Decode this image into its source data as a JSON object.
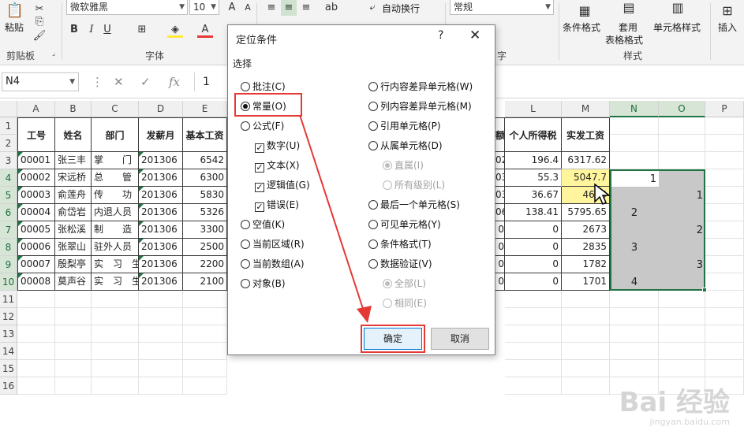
{
  "ribbon": {
    "paste_label": "粘贴",
    "clipboard_group": "剪贴板",
    "font_name": "微软雅黑",
    "font_size": "10",
    "font_group": "字体",
    "wrap_text": "自动换行",
    "number_format": "常规",
    "number_group_tail": "字",
    "cond_format": "条件格式",
    "table_format_1": "套用",
    "table_format_2": "表格格式",
    "cell_style": "单元格样式",
    "styles_group": "样式",
    "insert": "插入",
    "bold": "B",
    "italic": "I",
    "underline": "U"
  },
  "formula_bar": {
    "name_box": "N4",
    "formula_value": "1",
    "fx": "fx"
  },
  "columns": [
    "A",
    "B",
    "C",
    "D",
    "E",
    "L",
    "M",
    "N",
    "O",
    "P"
  ],
  "rows": [
    "1",
    "2",
    "3",
    "4",
    "5",
    "6",
    "7",
    "8",
    "9",
    "10",
    "11",
    "12",
    "13",
    "14",
    "15",
    "16"
  ],
  "table": {
    "headers": [
      "工号",
      "姓名",
      "部门",
      "发薪月",
      "基本工资",
      "个人所得税",
      "实发工资"
    ],
    "data": [
      [
        "00001",
        "张三丰",
        "掌　　门",
        "201306",
        "6542",
        "196.4",
        "6317.62"
      ],
      [
        "00002",
        "宋远桥",
        "总　　管",
        "201306",
        "6300",
        "55.3",
        "5047.7"
      ],
      [
        "00003",
        "俞莲舟",
        "传　　功",
        "201306",
        "5830",
        "36.67",
        "4685"
      ],
      [
        "00004",
        "俞岱岩",
        "内退人员",
        "201306",
        "5326",
        "138.41",
        "5795.65"
      ],
      [
        "00005",
        "张松溪",
        "制　　造",
        "201306",
        "3300",
        "0",
        "2673"
      ],
      [
        "00006",
        "张翠山",
        "驻外人员",
        "201306",
        "2500",
        "0",
        "2835"
      ],
      [
        "00007",
        "殷梨亭",
        "实　习　生",
        "201306",
        "2200",
        "0",
        "1782"
      ],
      [
        "00008",
        "莫声谷",
        "实　习　生",
        "201306",
        "2100",
        "0",
        "1701"
      ]
    ],
    "hidden_fragments": [
      "02",
      "03",
      "03",
      "06",
      "0",
      "0",
      "0",
      "0"
    ],
    "hidden_header_fragment": "额"
  },
  "sequence": {
    "n4": "1",
    "o5": "1",
    "n6": "2",
    "o7": "2",
    "n8": "3",
    "o9": "3",
    "n10": "4"
  },
  "dialog": {
    "title": "定位条件",
    "help": "?",
    "close": "✕",
    "section": "选择",
    "left_options": [
      {
        "label": "批注(C)",
        "type": "radio",
        "checked": false,
        "disabled": false
      },
      {
        "label": "常量(O)",
        "type": "radio",
        "checked": true,
        "disabled": false
      },
      {
        "label": "公式(F)",
        "type": "radio",
        "checked": false,
        "disabled": false
      },
      {
        "label": "数字(U)",
        "type": "check",
        "checked": true,
        "disabled": false
      },
      {
        "label": "文本(X)",
        "type": "check",
        "checked": true,
        "disabled": false
      },
      {
        "label": "逻辑值(G)",
        "type": "check",
        "checked": true,
        "disabled": false
      },
      {
        "label": "错误(E)",
        "type": "check",
        "checked": true,
        "disabled": false
      },
      {
        "label": "空值(K)",
        "type": "radio",
        "checked": false,
        "disabled": false
      },
      {
        "label": "当前区域(R)",
        "type": "radio",
        "checked": false,
        "disabled": false
      },
      {
        "label": "当前数组(A)",
        "type": "radio",
        "checked": false,
        "disabled": false
      },
      {
        "label": "对象(B)",
        "type": "radio",
        "checked": false,
        "disabled": false
      }
    ],
    "right_options": [
      {
        "label": "行内容差异单元格(W)",
        "checked": false,
        "disabled": false
      },
      {
        "label": "列内容差异单元格(M)",
        "checked": false,
        "disabled": false
      },
      {
        "label": "引用单元格(P)",
        "checked": false,
        "disabled": false
      },
      {
        "label": "从属单元格(D)",
        "checked": false,
        "disabled": false
      },
      {
        "label": "直属(I)",
        "checked": true,
        "disabled": true
      },
      {
        "label": "所有级别(L)",
        "checked": false,
        "disabled": true
      },
      {
        "label": "最后一个单元格(S)",
        "checked": false,
        "disabled": false
      },
      {
        "label": "可见单元格(Y)",
        "checked": false,
        "disabled": false
      },
      {
        "label": "条件格式(T)",
        "checked": false,
        "disabled": false
      },
      {
        "label": "数据验证(V)",
        "checked": false,
        "disabled": false
      },
      {
        "label": "全部(L)",
        "checked": true,
        "disabled": true
      },
      {
        "label": "相同(E)",
        "checked": false,
        "disabled": true
      }
    ],
    "ok": "确定",
    "cancel": "取消"
  },
  "watermark": {
    "brand": "Bai  经验",
    "url": "jingyan.baidu.com"
  },
  "colors": {
    "accent_green": "#217346",
    "selection_gray": "#c8c8c8",
    "highlight_red": "#e53935"
  }
}
